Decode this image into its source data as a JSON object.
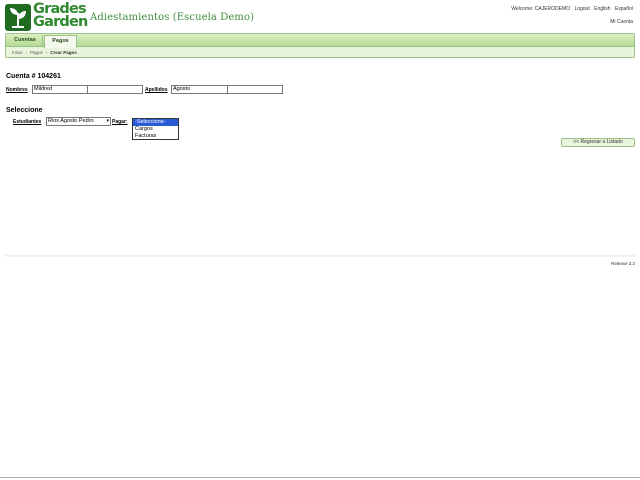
{
  "app": {
    "logo_text_line1": "Grades",
    "logo_text_line2": "Garden",
    "school_title": "Adiestamientos (Escuela Demo)",
    "brand_color": "#2e8a2e"
  },
  "toplinks": {
    "welcome": "Welcome: CAJERODEMO",
    "logout": "Logout",
    "english": "English",
    "espanol": "Español",
    "mi_cuenta": "Mi Cuenta"
  },
  "nav": {
    "tabs": [
      {
        "label": "Cuentas"
      },
      {
        "label": "Pagos",
        "active": true
      }
    ],
    "breadcrumb": [
      "Inicio",
      "Pagos",
      "Crear Pagos"
    ]
  },
  "account": {
    "title": "Cuenta # 104261",
    "nombres_label": "Nombres",
    "nombre1": "Mildred",
    "nombre2": "",
    "apellidos_label": "Apellidos",
    "apellido1": "Agosto",
    "apellido2": ""
  },
  "selection": {
    "title": "Seleccione",
    "estudiantes_label": "Estudiantes",
    "student_selected": "Rios Agosto Pedro",
    "pagar_label": "Pagar:",
    "pagar_options": [
      "-Seleccione-",
      "Cargos",
      "Facturas"
    ],
    "pagar_selected_index": 0
  },
  "actions": {
    "back_label": "<< Regresar a Listado"
  },
  "footer": {
    "release": "Release 3.2"
  }
}
